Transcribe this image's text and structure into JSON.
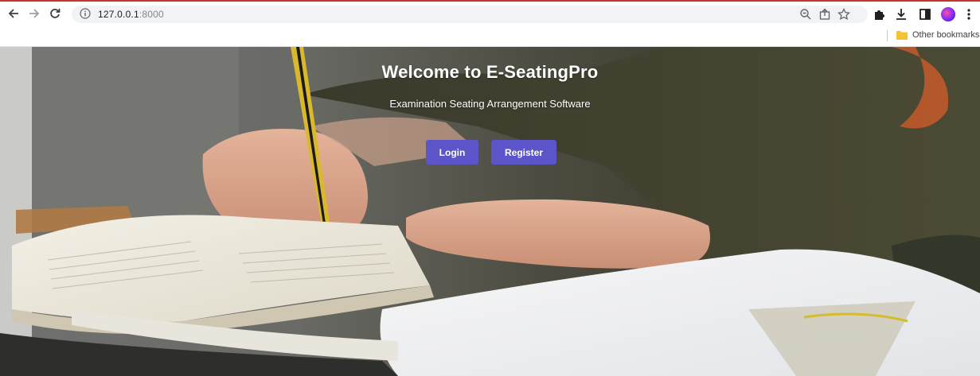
{
  "browser": {
    "url_host": "127.0.0.1",
    "url_port": ":8000",
    "bookmarks": {
      "other_label": "Other bookmarks"
    },
    "icons": {
      "back": "arrow-left-icon",
      "forward": "arrow-right-icon",
      "reload": "reload-icon",
      "info": "info-icon",
      "zoom": "zoom-icon",
      "share": "share-icon",
      "star": "star-icon",
      "extensions": "puzzle-icon",
      "download": "download-icon",
      "sidepanel": "side-panel-icon",
      "menu": "kebab-menu-icon",
      "folder": "folder-icon"
    }
  },
  "hero": {
    "title": "Welcome to E-SeatingPro",
    "subtitle": "Examination Seating Arrangement Software",
    "buttons": {
      "login": "Login",
      "register": "Register"
    }
  },
  "colors": {
    "button_bg": "#5b55c9",
    "text": "#ffffff",
    "tab_accent": "#c0392b"
  }
}
